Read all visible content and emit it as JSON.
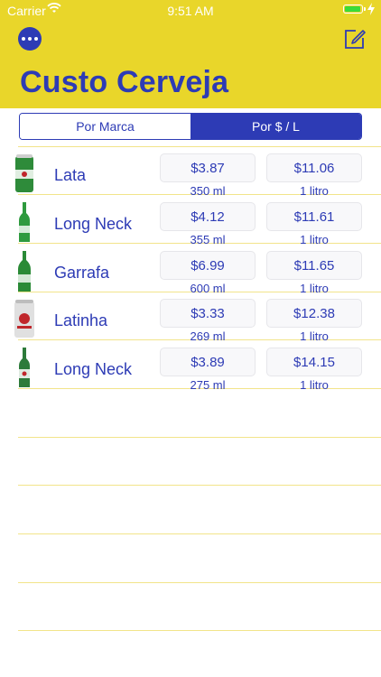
{
  "status_bar": {
    "carrier": "Carrier",
    "time": "9:51 AM"
  },
  "header": {
    "title": "Custo Cerveja"
  },
  "segmented": {
    "option_1": "Por Marca",
    "option_2": "Por $ / L",
    "selected": "Por $ / L"
  },
  "rows": [
    {
      "name": "Lata",
      "price": "$3.87",
      "volume": "350 ml",
      "price_per_liter": "$11.06",
      "unit": "1 litro",
      "bottle_color": "#2e8b3a"
    },
    {
      "name": "Long Neck",
      "price": "$4.12",
      "volume": "355 ml",
      "price_per_liter": "$11.61",
      "unit": "1 litro",
      "bottle_color": "#2e9a3e"
    },
    {
      "name": "Garrafa",
      "price": "$6.99",
      "volume": "600 ml",
      "price_per_liter": "$11.65",
      "unit": "1 litro",
      "bottle_color": "#2a8a36"
    },
    {
      "name": "Latinha",
      "price": "$3.33",
      "volume": "269 ml",
      "price_per_liter": "$12.38",
      "unit": "1 litro",
      "bottle_color": "#d8d8d8"
    },
    {
      "name": "Long Neck",
      "price": "$3.89",
      "volume": "275 ml",
      "price_per_liter": "$14.15",
      "unit": "1 litro",
      "bottle_color": "#2d7a3a"
    }
  ],
  "colors": {
    "header_bg": "#e9d62a",
    "accent": "#2d3bb5",
    "divider": "#f2e48a"
  },
  "icons": {
    "more": "ellipsis-icon",
    "edit": "compose-icon"
  }
}
